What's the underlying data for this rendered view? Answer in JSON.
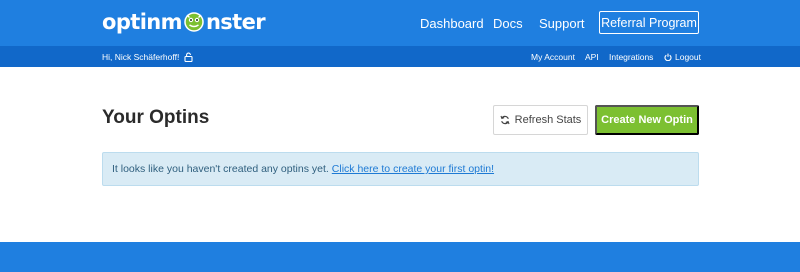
{
  "brand": {
    "logo_text_left": "optinm",
    "logo_text_right": "nster"
  },
  "nav": {
    "dashboard": "Dashboard",
    "docs": "Docs",
    "support": "Support",
    "referral": "Referral Program"
  },
  "subnav": {
    "greeting": "Hi, Nick Schäferhoff!",
    "my_account": "My Account",
    "api": "API",
    "integrations": "Integrations",
    "logout": "Logout"
  },
  "main": {
    "title": "Your Optins",
    "refresh_label": "Refresh Stats",
    "create_label": "Create New Optin",
    "notice_text": "It looks like you haven't created any optins yet.",
    "notice_link": "Click here to create your first optin!"
  },
  "colors": {
    "header_blue": "#1f7fe0",
    "subheader_blue": "#1168c9",
    "create_green": "#7cc031",
    "notice_bg": "#d9ebf5"
  },
  "icons": {
    "logo": "monster-icon",
    "lock": "lock-icon",
    "logout": "power-icon",
    "refresh": "refresh-icon"
  }
}
